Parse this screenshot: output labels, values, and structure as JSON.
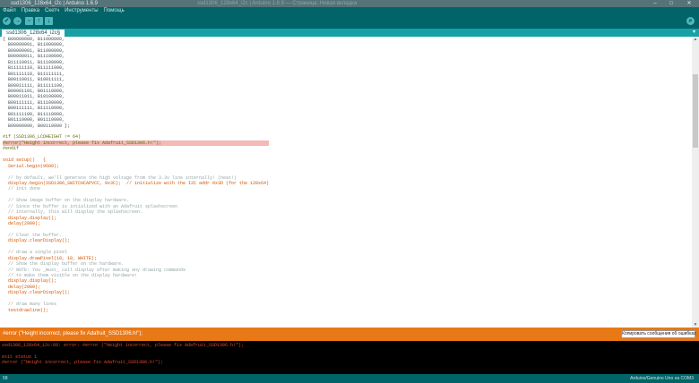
{
  "window": {
    "title": "ssd1306_128x64_i2c | Arduino 1.6.9",
    "ghost_title": "ssd1306_128x64_i2c | Arduino 1.6.9 — Страница: Новая вкладка",
    "controls": [
      "–",
      "□",
      "✕"
    ]
  },
  "menu": [
    "Файл",
    "Правка",
    "Скетч",
    "Инструменты",
    "Помощь"
  ],
  "toolbar": {
    "verify_icon": "check-icon",
    "upload_icon": "arrow-right-icon",
    "new_icon": "new-file-icon",
    "open_icon": "arrow-up-icon",
    "save_icon": "arrow-down-icon",
    "serial_icon": "magnifier-icon"
  },
  "tab": {
    "name": "ssd1306_128x64_i2c§"
  },
  "code_lines": [
    {
      "t": "{ B00000000, B11000000,"
    },
    {
      "t": "  B00000001, B11000000,"
    },
    {
      "t": "  B00000001, B11000000,"
    },
    {
      "t": "  B00000011, B11100000,"
    },
    {
      "t": "  B11110011, B11100000,"
    },
    {
      "t": "  B11111110, B11111000,"
    },
    {
      "t": "  B01111110, B11111111,"
    },
    {
      "t": "  B00110011, B10011111,"
    },
    {
      "t": "  B00011111, B11111100,"
    },
    {
      "t": "  B00001101, B01110000,"
    },
    {
      "t": "  B00011011, B10100000,"
    },
    {
      "t": "  B00111111, B11100000,"
    },
    {
      "t": "  B00111111, B11110000,"
    },
    {
      "t": "  B01111100, B11110000,"
    },
    {
      "t": "  B01110000, B01110000,"
    },
    {
      "t": "  B00000000, B00110000 };"
    },
    {
      "t": ""
    },
    {
      "t": "#if (SSD1306_LCDHEIGHT != 64)",
      "k": "pp"
    },
    {
      "t": "#error(\"Height incorrect, please fix Adafruit_SSD1306.h!\");",
      "k": "pp",
      "err": true
    },
    {
      "t": "#endif",
      "k": "pp"
    },
    {
      "t": ""
    },
    {
      "t": "void setup()   {",
      "k": "kw"
    },
    {
      "t": "  Serial.begin(9600);",
      "k": "fn"
    },
    {
      "t": ""
    },
    {
      "t": "  // by default, we'll generate the high voltage from the 3.3v line internally! (neat!)",
      "k": "cm"
    },
    {
      "t": "  display.begin(SSD1306_SWITCHCAPVCC, 0x3C);  // initialize with the I2C addr 0x3D (for the 128x64)",
      "k": "fn"
    },
    {
      "t": "  // init done",
      "k": "cm"
    },
    {
      "t": ""
    },
    {
      "t": "  // Show image buffer on the display hardware.",
      "k": "cm"
    },
    {
      "t": "  // Since the buffer is intialized with an Adafruit splashscreen",
      "k": "cm"
    },
    {
      "t": "  // internally, this will display the splashscreen.",
      "k": "cm"
    },
    {
      "t": "  display.display();",
      "k": "fn"
    },
    {
      "t": "  delay(2000);",
      "k": "fn"
    },
    {
      "t": ""
    },
    {
      "t": "  // Clear the buffer.",
      "k": "cm"
    },
    {
      "t": "  display.clearDisplay();",
      "k": "fn"
    },
    {
      "t": ""
    },
    {
      "t": "  // draw a single pixel",
      "k": "cm"
    },
    {
      "t": "  display.drawPixel(10, 10, WHITE);",
      "k": "fn"
    },
    {
      "t": "  // Show the display buffer on the hardware.",
      "k": "cm"
    },
    {
      "t": "  // NOTE: You _must_ call display after making any drawing commands",
      "k": "cm"
    },
    {
      "t": "  // to make them visible on the display hardware!",
      "k": "cm"
    },
    {
      "t": "  display.display();",
      "k": "fn"
    },
    {
      "t": "  delay(2000);",
      "k": "fn"
    },
    {
      "t": "  display.clearDisplay();",
      "k": "fn"
    },
    {
      "t": ""
    },
    {
      "t": "  // draw many lines",
      "k": "cm"
    },
    {
      "t": "  testdrawline();",
      "k": "fn"
    }
  ],
  "status": {
    "message": "#error (\"Height incorrect, please fix Adafruit_SSD1306.h!\");",
    "copy_button": "Копировать сообщения об ошибках"
  },
  "console": {
    "lines": [
      "ssd1306_128x64_i2c:60: error: #error (\"Height incorrect, please fix Adafruit_SSD1306.h!\");",
      "",
      "exit status 1",
      "#error (\"Height incorrect, please fix Adafruit_SSD1306.h!\");"
    ]
  },
  "bottom": {
    "line_number": "58",
    "board": "Arduino/Genuino Uno на COM3"
  },
  "colors": {
    "teal_dark": "#006468",
    "teal_tab": "#17a1a5",
    "error_orange": "#e97817",
    "error_highlight": "#f4b8b5",
    "console_bg": "#000000",
    "console_text": "#e34c26"
  }
}
